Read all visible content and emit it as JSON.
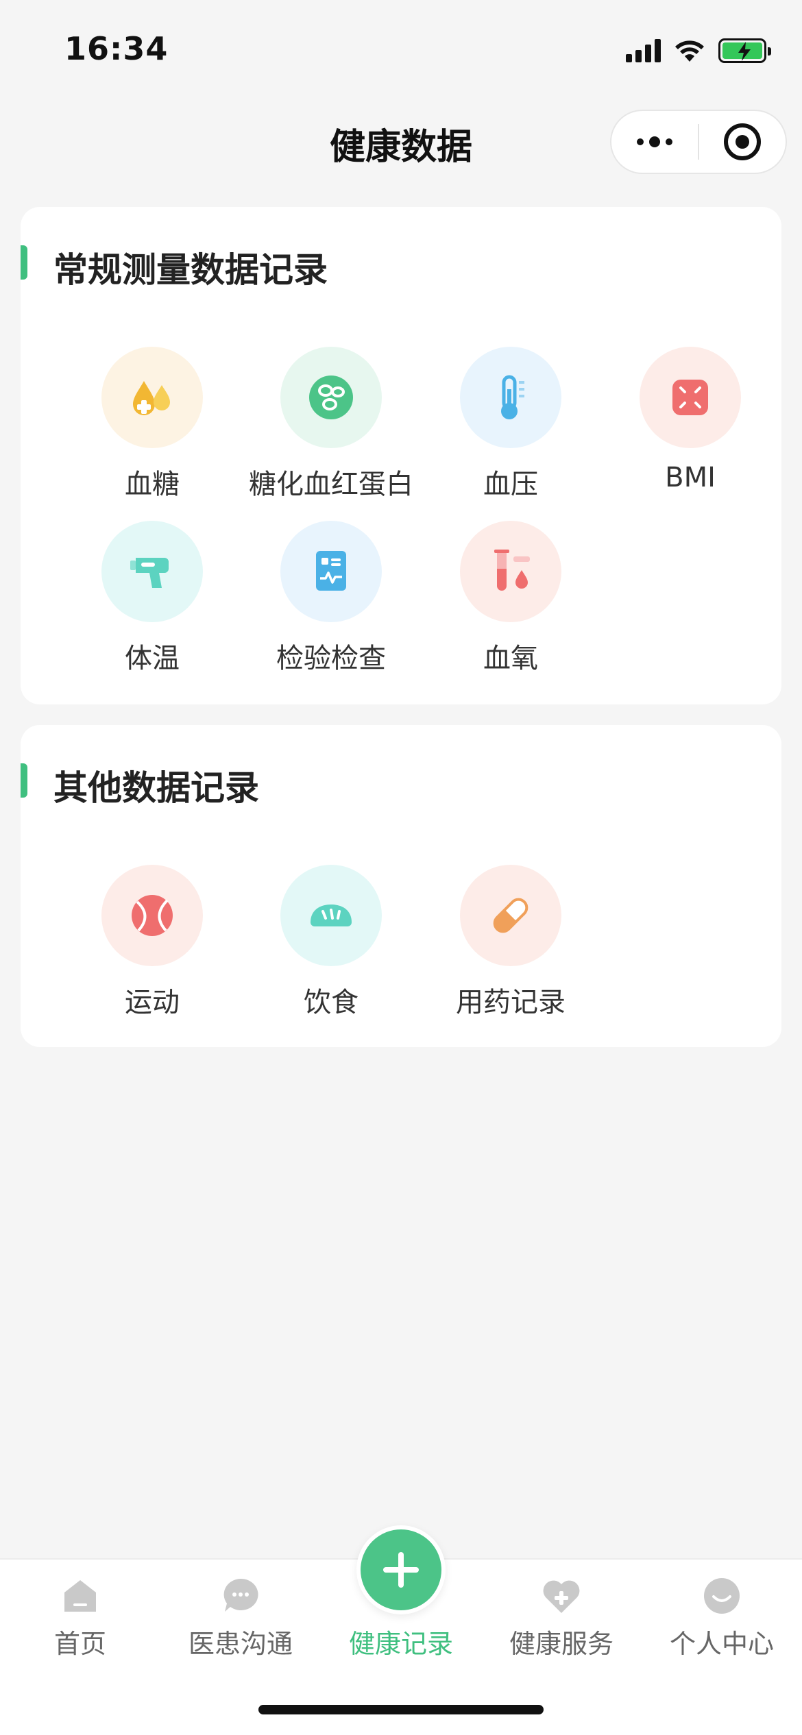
{
  "status_bar": {
    "time": "16:34"
  },
  "nav": {
    "title": "健康数据"
  },
  "colors": {
    "accent": "#3fbf7f",
    "background": "#f5f5f5",
    "card": "#ffffff"
  },
  "sections": [
    {
      "title": "常规测量数据记录",
      "items": [
        {
          "label": "血糖",
          "icon": "blood-drop-icon"
        },
        {
          "label": "糖化血红蛋白",
          "icon": "cells-icon"
        },
        {
          "label": "血压",
          "icon": "thermometer-icon"
        },
        {
          "label": "BMI",
          "icon": "scale-icon"
        },
        {
          "label": "体温",
          "icon": "temperature-gun-icon"
        },
        {
          "label": "检验检查",
          "icon": "lab-report-icon"
        },
        {
          "label": "血氧",
          "icon": "test-tube-icon"
        }
      ]
    },
    {
      "title": "其他数据记录",
      "items": [
        {
          "label": "运动",
          "icon": "ball-icon"
        },
        {
          "label": "饮食",
          "icon": "bread-icon"
        },
        {
          "label": "用药记录",
          "icon": "pill-icon"
        }
      ]
    }
  ],
  "tabbar": {
    "items": [
      {
        "label": "首页",
        "icon": "home-icon",
        "active": false
      },
      {
        "label": "医患沟通",
        "icon": "chat-icon",
        "active": false
      },
      {
        "label": "健康记录",
        "icon": "plus-icon",
        "active": true
      },
      {
        "label": "健康服务",
        "icon": "heart-plus-icon",
        "active": false
      },
      {
        "label": "个人中心",
        "icon": "profile-icon",
        "active": false
      }
    ]
  }
}
